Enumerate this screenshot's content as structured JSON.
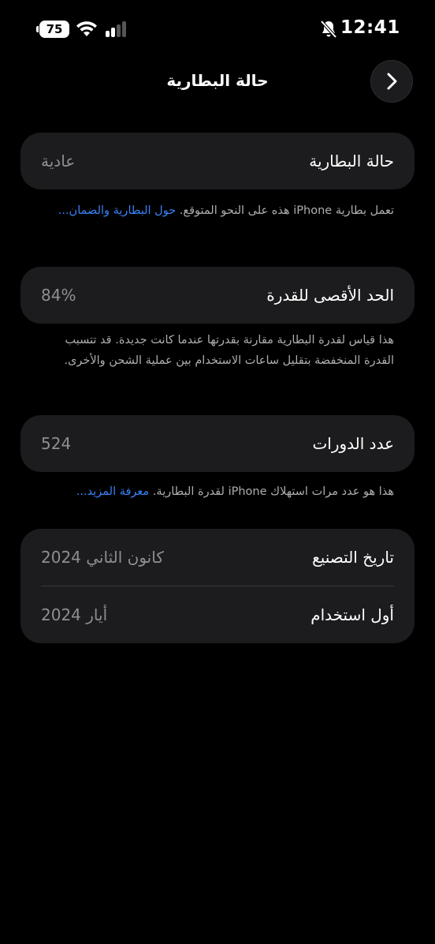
{
  "status_bar": {
    "battery_level": "75",
    "time": "12:41"
  },
  "nav": {
    "title": "حالة البطارية"
  },
  "health": {
    "label": "حالة البطارية",
    "value": "عادية",
    "note": "تعمل بطارية iPhone هذه على النحو المتوقع.",
    "link": "حول البطارية والضمان..."
  },
  "capacity": {
    "label": "الحد الأقصى للقدرة",
    "value": "84%",
    "note": "هذا قياس لقدرة البطارية مقارنة بقدرتها عندما كانت جديدة. قد تتسبب القدرة المنخفضة بتقليل ساعات الاستخدام بين عملية الشحن والأخرى."
  },
  "cycles": {
    "label": "عدد الدورات",
    "value": "524",
    "note": "هذا هو عدد مرات استهلاك iPhone لقدرة البطارية.",
    "link": "معرفة المزيد..."
  },
  "dates": {
    "manufacture_label": "تاريخ التصنيع",
    "manufacture_value": "كانون الثاني 2024",
    "first_use_label": "أول استخدام",
    "first_use_value": "أيار 2024"
  }
}
